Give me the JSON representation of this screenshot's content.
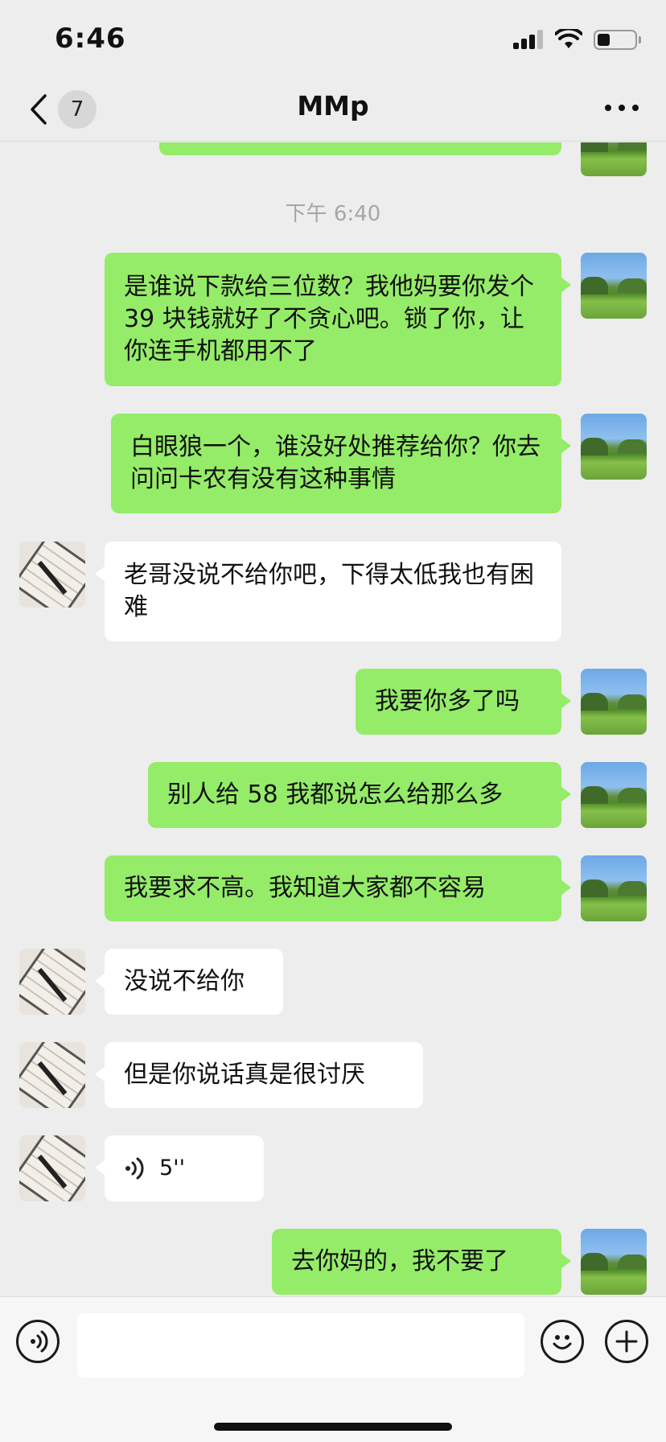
{
  "status_bar": {
    "time": "6:46",
    "battery_level": 0.35
  },
  "nav": {
    "back_count": "7",
    "title": "MMp"
  },
  "chat": {
    "timestamp": "下午 6:40",
    "messages": [
      {
        "side": "right",
        "text": "是谁说下款给三位数？我他妈要你发个 39 块钱就好了不贪心吧。锁了你，让你连手机都用不了"
      },
      {
        "side": "right",
        "text": "白眼狼一个，谁没好处推荐给你？你去问问卡农有没有这种事情"
      },
      {
        "side": "left",
        "text": "老哥没说不给你吧，下得太低我也有困难"
      },
      {
        "side": "right",
        "text": "我要你多了吗"
      },
      {
        "side": "right",
        "text": "别人给 58 我都说怎么给那么多"
      },
      {
        "side": "right",
        "text": "我要求不高。我知道大家都不容易"
      },
      {
        "side": "left",
        "text": "没说不给你"
      },
      {
        "side": "left",
        "text": "但是你说话真是很讨厌"
      },
      {
        "side": "left",
        "type": "voice",
        "text": "5''"
      },
      {
        "side": "right",
        "text": "去你妈的，我不要了"
      }
    ]
  },
  "input_bar": {
    "value": "",
    "icons": [
      "voice-icon",
      "emoji-icon",
      "plus-icon"
    ]
  },
  "colors": {
    "sent_bubble": "#95ec69",
    "received_bubble": "#ffffff",
    "background": "#ededed"
  }
}
